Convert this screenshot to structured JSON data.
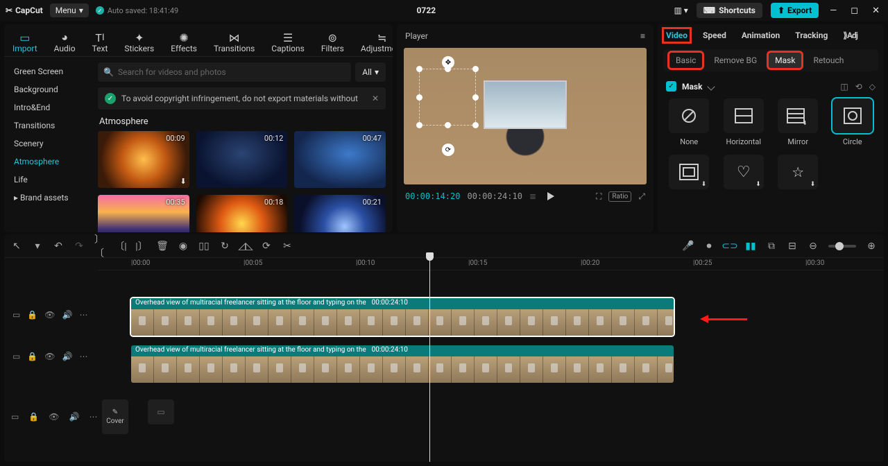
{
  "title": "0722",
  "brand": "CapCut",
  "menu_label": "Menu",
  "autosave": "Auto saved: 18:41:49",
  "shortcuts": "Shortcuts",
  "export": "Export",
  "top_tabs": [
    "Import",
    "Audio",
    "Text",
    "Stickers",
    "Effects",
    "Transitions",
    "Captions",
    "Filters",
    "Adjustment"
  ],
  "top_tab_active": 0,
  "side_items": [
    "Green Screen",
    "Background",
    "Intro&End",
    "Transitions",
    "Scenery",
    "Atmosphere",
    "Life"
  ],
  "side_active": 5,
  "brand_assets": "Brand assets",
  "search_placeholder": "Search for videos and photos",
  "all_label": "All",
  "notice": "To avoid copyright infringement, do not export materials without",
  "section": "Atmosphere",
  "thumbs": [
    "00:09",
    "00:12",
    "00:47",
    "00:35",
    "00:18",
    "00:21"
  ],
  "player_label": "Player",
  "timecode1": "00:00:14:20",
  "timecode2": "00:00:24:10",
  "ratio_label": "Ratio",
  "prop_tabs": [
    "Video",
    "Speed",
    "Animation",
    "Tracking",
    "Adj"
  ],
  "prop_tab_active": 0,
  "sub_tabs": [
    "Basic",
    "Remove BG",
    "Mask",
    "Retouch"
  ],
  "sub_active": 2,
  "mask_label": "Mask",
  "mask_shapes": [
    "None",
    "Horizontal",
    "Mirror",
    "Circle"
  ],
  "ruler": [
    "|00:00",
    "|00:05",
    "|00:10",
    "|00:15",
    "|00:20",
    "|00:25",
    "|00:30"
  ],
  "clip_title": "Overhead view of multiracial freelancer sitting at the floor and typing on the",
  "clip_dur": "00:00:24:10",
  "cover_label": "Cover"
}
